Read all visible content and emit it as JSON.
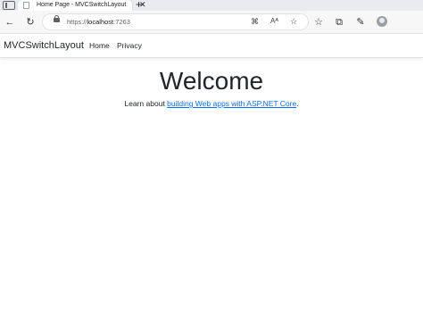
{
  "browser": {
    "tab_title": "Home Page - MVCSwitchLayout",
    "tab_close": "✕",
    "new_tab": "+",
    "url_scheme": "https://",
    "url_host": "localhost",
    "url_port": ":7263",
    "icons": [
      "tab-actions-icon",
      "back-icon",
      "refresh-icon",
      "lock-icon",
      "app-available-icon",
      "read-aloud-icon",
      "favorite-icon",
      "favorites-bar-icon",
      "collections-icon",
      "extensions-icon",
      "profile-avatar"
    ]
  },
  "navbar": {
    "brand": "MVCSwitchLayout",
    "links": [
      "Home",
      "Privacy"
    ]
  },
  "main": {
    "heading": "Welcome",
    "learn_prefix": "Learn about ",
    "learn_link": "building Web apps with ASP.NET Core",
    "learn_suffix": "."
  },
  "colors": {
    "link": "#0d6efd",
    "text": "#212529",
    "toolbar": "#f7f7f7",
    "tabstrip": "#e9ebee"
  }
}
